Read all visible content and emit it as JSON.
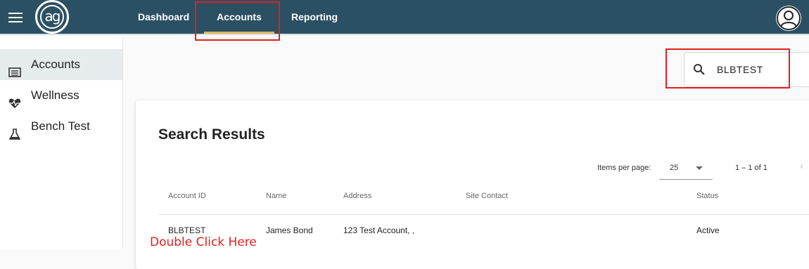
{
  "header": {
    "logo_text": "ag",
    "nav": [
      {
        "label": "Dashboard"
      },
      {
        "label": "Accounts"
      },
      {
        "label": "Reporting"
      }
    ],
    "accent_color": "#e0b65c",
    "bar_color": "#2b5063"
  },
  "sidebar": {
    "items": [
      {
        "label": "Accounts",
        "icon": "list-icon",
        "active": true
      },
      {
        "label": "Wellness",
        "icon": "heart-pulse-icon",
        "active": false
      },
      {
        "label": "Bench Test",
        "icon": "flask-icon",
        "active": false
      }
    ]
  },
  "search": {
    "value": "BLBTEST",
    "icon": "search-icon"
  },
  "results": {
    "title": "Search Results",
    "paginator": {
      "items_per_page_label": "Items per page:",
      "items_per_page_value": "25",
      "range_label": "1 – 1 of 1"
    },
    "columns": [
      "Account ID",
      "Name",
      "Address",
      "Site Contact",
      "Status"
    ],
    "rows": [
      {
        "account_id": "BLBTEST",
        "name": "James Bond",
        "address": "123 Test Account, ,",
        "site_contact": "",
        "status": "Active"
      }
    ]
  },
  "annotation": {
    "text": "Double Click Here",
    "color": "#e02020"
  }
}
